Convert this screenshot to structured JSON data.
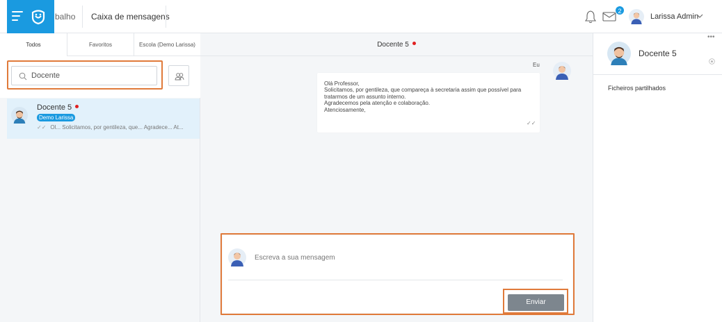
{
  "header": {
    "breadcrumb_partial": "balho",
    "title": "Caixa de mensagens",
    "notifications_count": "2",
    "user_name": "Larissa Admin"
  },
  "tabs": [
    {
      "label": "Todos"
    },
    {
      "label": "Favoritos"
    },
    {
      "label": "Escola (Demo Larissa)"
    }
  ],
  "search": {
    "value": "Docente"
  },
  "conversation": {
    "name": "Docente 5",
    "tag": "Demo Larissa",
    "preview": "Ol... Solicitamos, por gentileza, que... Agradece... At..."
  },
  "chat": {
    "title": "Docente 5",
    "sender": "Eu",
    "message_lines": [
      "Olá Professor,",
      "Solicitamos, por gentileza, que compareça à secretaria assim que possível para",
      "tratarmos de um assunto interno.",
      "Agradecemos pela atenção e colaboração.",
      "Atenciosamente,"
    ],
    "composer_placeholder": "Escreva a sua mensagem",
    "send_label": "Enviar"
  },
  "details": {
    "name": "Docente 5",
    "shared_files_label": "Ficheiros partilhados"
  },
  "colors": {
    "accent": "#1a9ae0",
    "highlight": "#e07a3a",
    "online_dot": "#e02020",
    "send_button": "#7d868e"
  }
}
